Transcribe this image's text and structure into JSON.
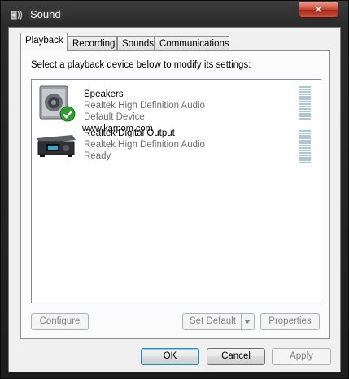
{
  "window": {
    "title": "Sound",
    "close_glyph": "✕",
    "icon": "speaker-sound-icon"
  },
  "tabs": [
    {
      "label": "Playback",
      "active": true
    },
    {
      "label": "Recording",
      "active": false
    },
    {
      "label": "Sounds",
      "active": false
    },
    {
      "label": "Communications",
      "active": false
    }
  ],
  "instruction": "Select a playback device below to modify its settings:",
  "devices": [
    {
      "name": "Speakers",
      "driver": "Realtek High Definition Audio",
      "status": "Default Device",
      "icon": "speakers-icon",
      "default_badge": "check-icon"
    },
    {
      "name": "Realtek Digital Output",
      "driver": "Realtek High Definition Audio",
      "status": "Ready",
      "icon": "digital-output-icon"
    }
  ],
  "watermark": "www.karpom.com",
  "buttons": {
    "configure": "Configure",
    "set_default": "Set Default",
    "properties": "Properties",
    "ok": "OK",
    "cancel": "Cancel",
    "apply": "Apply"
  },
  "colors": {
    "meter": "#a9c7d7",
    "accent_default_button": "#3c7fb1",
    "close_button": "#c9442e"
  }
}
